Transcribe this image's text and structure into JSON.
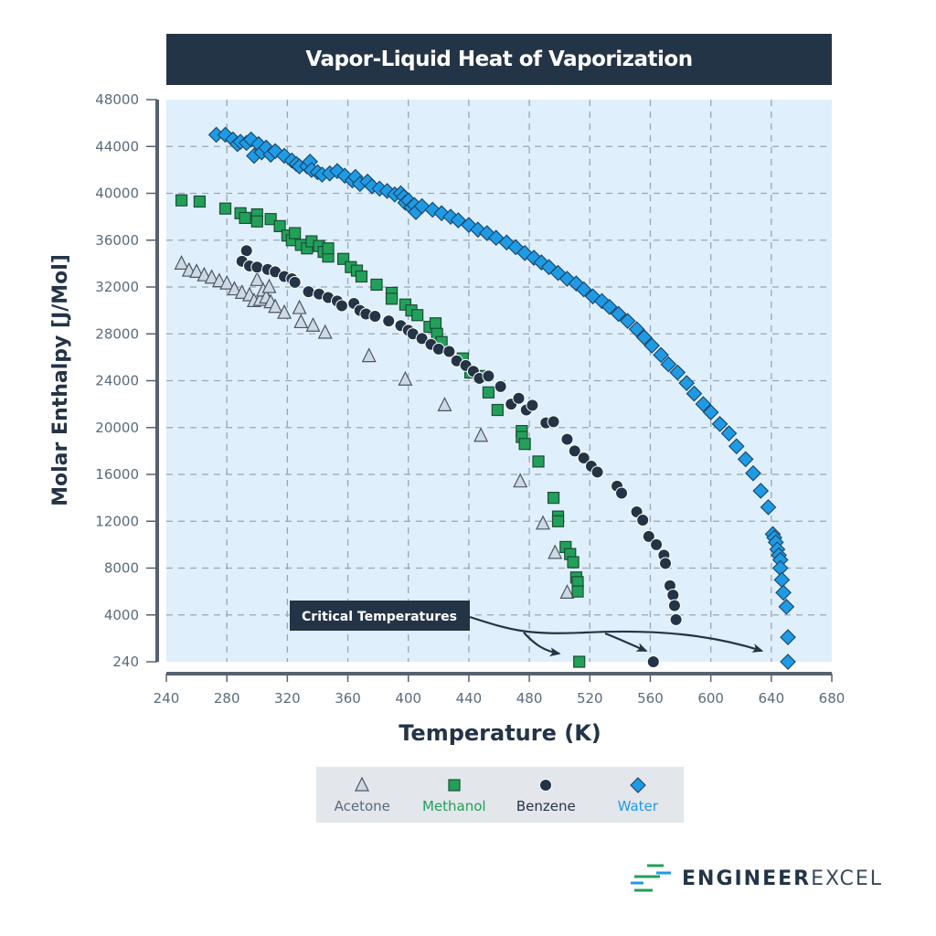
{
  "chart_data": {
    "type": "scatter",
    "title": "Vapor-Liquid Heat of Vaporization",
    "xlabel": "Temperature (K)",
    "ylabel": "Molar Enthalpy [J/Mol]",
    "xlim": [
      240,
      680
    ],
    "ylim": [
      0,
      48000
    ],
    "x_ticks": [
      240,
      280,
      320,
      360,
      400,
      440,
      480,
      520,
      560,
      600,
      640,
      680
    ],
    "y_ticks": [
      {
        "value": 0,
        "label": "240"
      },
      {
        "value": 4000,
        "label": "4000"
      },
      {
        "value": 8000,
        "label": "8000"
      },
      {
        "value": 12000,
        "label": "12000"
      },
      {
        "value": 16000,
        "label": "16000"
      },
      {
        "value": 20000,
        "label": "20000"
      },
      {
        "value": 24000,
        "label": "24000"
      },
      {
        "value": 28000,
        "label": "28000"
      },
      {
        "value": 32000,
        "label": "32000"
      },
      {
        "value": 36000,
        "label": "36000"
      },
      {
        "value": 40000,
        "label": "40000"
      },
      {
        "value": 44000,
        "label": "44000"
      },
      {
        "value": 48000,
        "label": "48000"
      }
    ],
    "grid": true,
    "legend_position": "bottom",
    "annotation": {
      "text": "Critical Temperatures",
      "targets": [
        [
          513,
          0
        ],
        [
          562,
          0
        ],
        [
          647,
          0
        ]
      ]
    },
    "series": [
      {
        "name": "Acetone",
        "marker": "triangle",
        "color": "#cfd9e3",
        "stroke": "#4a5766",
        "label_color": "#5a6b7b",
        "points": [
          [
            250,
            34000
          ],
          [
            255,
            33400
          ],
          [
            260,
            33300
          ],
          [
            265,
            33000
          ],
          [
            270,
            32800
          ],
          [
            275,
            32500
          ],
          [
            280,
            32300
          ],
          [
            285,
            31800
          ],
          [
            290,
            31500
          ],
          [
            295,
            31300
          ],
          [
            298,
            30800
          ],
          [
            300,
            32600
          ],
          [
            302,
            30900
          ],
          [
            304,
            31700
          ],
          [
            306,
            31100
          ],
          [
            308,
            32000
          ],
          [
            309,
            30700
          ],
          [
            312,
            30300
          ],
          [
            318,
            29800
          ],
          [
            328,
            30200
          ],
          [
            329,
            29000
          ],
          [
            337,
            28700
          ],
          [
            345,
            28100
          ],
          [
            374,
            26100
          ],
          [
            398,
            24100
          ],
          [
            424,
            21900
          ],
          [
            448,
            19300
          ],
          [
            474,
            15400
          ],
          [
            489,
            11800
          ],
          [
            497,
            9300
          ],
          [
            505,
            5900
          ]
        ]
      },
      {
        "name": "Methanol",
        "marker": "square",
        "color": "#22a05a",
        "stroke": "#1b4d36",
        "label_color": "#22a05a",
        "points": [
          [
            250,
            39400
          ],
          [
            262,
            39300
          ],
          [
            279,
            38700
          ],
          [
            289,
            38300
          ],
          [
            292,
            37900
          ],
          [
            300,
            38200
          ],
          [
            300,
            37600
          ],
          [
            309,
            37800
          ],
          [
            315,
            37200
          ],
          [
            320,
            36400
          ],
          [
            323,
            36000
          ],
          [
            325,
            36600
          ],
          [
            329,
            35600
          ],
          [
            333,
            35300
          ],
          [
            336,
            35900
          ],
          [
            341,
            35500
          ],
          [
            344,
            35000
          ],
          [
            347,
            34600
          ],
          [
            347,
            35300
          ],
          [
            357,
            34400
          ],
          [
            362,
            33700
          ],
          [
            366,
            33400
          ],
          [
            369,
            32900
          ],
          [
            379,
            32200
          ],
          [
            389,
            31500
          ],
          [
            389,
            31000
          ],
          [
            398,
            30500
          ],
          [
            402,
            30000
          ],
          [
            406,
            29600
          ],
          [
            414,
            28600
          ],
          [
            418,
            28900
          ],
          [
            419,
            28000
          ],
          [
            422,
            27300
          ],
          [
            436,
            25900
          ],
          [
            441,
            24700
          ],
          [
            447,
            24400
          ],
          [
            453,
            23000
          ],
          [
            459,
            21500
          ],
          [
            475,
            19700
          ],
          [
            475,
            19200
          ],
          [
            477,
            18600
          ],
          [
            486,
            17100
          ],
          [
            496,
            14000
          ],
          [
            499,
            12400
          ],
          [
            499,
            12000
          ],
          [
            504,
            9800
          ],
          [
            507,
            9200
          ],
          [
            509,
            8500
          ],
          [
            511,
            7200
          ],
          [
            512,
            6800
          ],
          [
            512,
            6000
          ],
          [
            513,
            0
          ]
        ]
      },
      {
        "name": "Benzene",
        "marker": "circle",
        "color": "#243447",
        "stroke": "#ffffff",
        "label_color": "#243447",
        "points": [
          [
            293,
            35100
          ],
          [
            290,
            34200
          ],
          [
            295,
            33800
          ],
          [
            300,
            33700
          ],
          [
            307,
            33500
          ],
          [
            312,
            33300
          ],
          [
            318,
            32900
          ],
          [
            323,
            32700
          ],
          [
            325,
            32400
          ],
          [
            334,
            31600
          ],
          [
            341,
            31400
          ],
          [
            347,
            31100
          ],
          [
            353,
            30800
          ],
          [
            356,
            30400
          ],
          [
            364,
            30600
          ],
          [
            368,
            30000
          ],
          [
            372,
            29700
          ],
          [
            378,
            29500
          ],
          [
            387,
            29100
          ],
          [
            395,
            28700
          ],
          [
            400,
            28300
          ],
          [
            403,
            28000
          ],
          [
            409,
            27600
          ],
          [
            415,
            27100
          ],
          [
            420,
            26700
          ],
          [
            427,
            26500
          ],
          [
            432,
            25700
          ],
          [
            438,
            25300
          ],
          [
            443,
            24800
          ],
          [
            447,
            24200
          ],
          [
            453,
            24400
          ],
          [
            461,
            23500
          ],
          [
            468,
            22000
          ],
          [
            473,
            22500
          ],
          [
            478,
            21500
          ],
          [
            482,
            21900
          ],
          [
            491,
            20400
          ],
          [
            496,
            20500
          ],
          [
            505,
            19000
          ],
          [
            510,
            18000
          ],
          [
            516,
            17400
          ],
          [
            521,
            16700
          ],
          [
            525,
            16200
          ],
          [
            538,
            15000
          ],
          [
            541,
            14400
          ],
          [
            551,
            12800
          ],
          [
            555,
            12100
          ],
          [
            559,
            10700
          ],
          [
            564,
            10000
          ],
          [
            569,
            9100
          ],
          [
            570,
            8400
          ],
          [
            573,
            6500
          ],
          [
            575,
            5700
          ],
          [
            576,
            4800
          ],
          [
            577,
            3600
          ],
          [
            562,
            0
          ]
        ]
      },
      {
        "name": "Water",
        "marker": "diamond",
        "color": "#1f9be6",
        "stroke": "#1d4a6d",
        "label_color": "#1f9be6",
        "points": [
          [
            273,
            45000
          ],
          [
            279,
            45000
          ],
          [
            284,
            44600
          ],
          [
            287,
            44200
          ],
          [
            289,
            44400
          ],
          [
            293,
            44300
          ],
          [
            296,
            44600
          ],
          [
            298,
            43200
          ],
          [
            301,
            44200
          ],
          [
            303,
            43500
          ],
          [
            306,
            43900
          ],
          [
            309,
            43300
          ],
          [
            312,
            43600
          ],
          [
            318,
            43200
          ],
          [
            323,
            42800
          ],
          [
            326,
            42500
          ],
          [
            328,
            42300
          ],
          [
            333,
            42300
          ],
          [
            335,
            42700
          ],
          [
            336,
            42000
          ],
          [
            340,
            41800
          ],
          [
            343,
            41600
          ],
          [
            348,
            41700
          ],
          [
            353,
            41900
          ],
          [
            358,
            41500
          ],
          [
            363,
            41100
          ],
          [
            365,
            41400
          ],
          [
            368,
            40800
          ],
          [
            373,
            41000
          ],
          [
            376,
            40600
          ],
          [
            381,
            40400
          ],
          [
            386,
            40200
          ],
          [
            391,
            39900
          ],
          [
            395,
            40000
          ],
          [
            397,
            39700
          ],
          [
            398,
            39200
          ],
          [
            400,
            39400
          ],
          [
            402,
            38800
          ],
          [
            404,
            39000
          ],
          [
            405,
            38400
          ],
          [
            409,
            38900
          ],
          [
            416,
            38600
          ],
          [
            422,
            38300
          ],
          [
            428,
            38000
          ],
          [
            433,
            37700
          ],
          [
            440,
            37300
          ],
          [
            446,
            36900
          ],
          [
            452,
            36600
          ],
          [
            458,
            36200
          ],
          [
            465,
            35800
          ],
          [
            471,
            35400
          ],
          [
            477,
            34900
          ],
          [
            483,
            34500
          ],
          [
            488,
            34100
          ],
          [
            493,
            33700
          ],
          [
            499,
            33200
          ],
          [
            505,
            32700
          ],
          [
            511,
            32300
          ],
          [
            516,
            31800
          ],
          [
            522,
            31200
          ],
          [
            528,
            30800
          ],
          [
            533,
            30300
          ],
          [
            539,
            29700
          ],
          [
            545,
            29100
          ],
          [
            551,
            28400
          ],
          [
            556,
            27700
          ],
          [
            561,
            27000
          ],
          [
            567,
            26200
          ],
          [
            572,
            25400
          ],
          [
            578,
            24700
          ],
          [
            584,
            23800
          ],
          [
            589,
            22900
          ],
          [
            595,
            22000
          ],
          [
            600,
            21300
          ],
          [
            606,
            20300
          ],
          [
            612,
            19500
          ],
          [
            617,
            18400
          ],
          [
            623,
            17300
          ],
          [
            628,
            16100
          ],
          [
            633,
            14600
          ],
          [
            638,
            13200
          ],
          [
            641,
            10900
          ],
          [
            642,
            10600
          ],
          [
            643,
            10200
          ],
          [
            644,
            9600
          ],
          [
            645,
            9100
          ],
          [
            646,
            8700
          ],
          [
            646,
            8000
          ],
          [
            647,
            7000
          ],
          [
            648,
            5900
          ],
          [
            650,
            4700
          ],
          [
            651,
            2100
          ],
          [
            651,
            0
          ]
        ]
      }
    ]
  },
  "branding": {
    "logo_bold": "ENGINEER",
    "logo_light": "EXCEL"
  }
}
